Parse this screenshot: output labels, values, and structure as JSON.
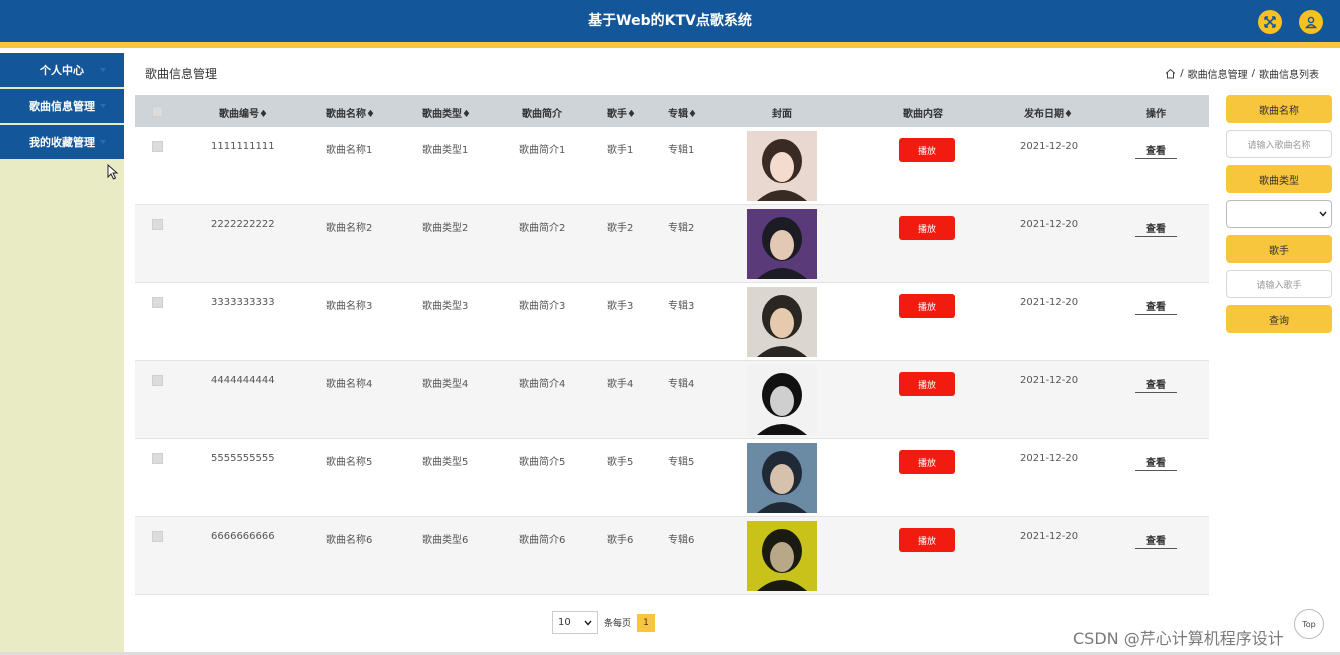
{
  "app": {
    "title": "基于Web的KTV点歌系统"
  },
  "header_icons": [
    "fullscreen-icon",
    "user-icon"
  ],
  "sidebar": {
    "items": [
      {
        "label": "个人中心"
      },
      {
        "label": "歌曲信息管理"
      },
      {
        "label": "我的收藏管理"
      }
    ]
  },
  "page": {
    "title": "歌曲信息管理",
    "breadcrumb": [
      "歌曲信息管理",
      "歌曲信息列表"
    ],
    "breadcrumb_sep": "/"
  },
  "table": {
    "columns": [
      "歌曲编号",
      "歌曲名称",
      "歌曲类型",
      "歌曲简介",
      "歌手",
      "专辑",
      "封面",
      "歌曲内容",
      "发布日期",
      "操作"
    ],
    "sortable_marker": "♦",
    "play_label": "播放",
    "view_label": "查看",
    "rows": [
      {
        "id": "1111111111",
        "name": "歌曲名称1",
        "type": "歌曲类型1",
        "intro": "歌曲简介1",
        "singer": "歌手1",
        "album": "专辑1",
        "date": "2021-12-20"
      },
      {
        "id": "2222222222",
        "name": "歌曲名称2",
        "type": "歌曲类型2",
        "intro": "歌曲简介2",
        "singer": "歌手2",
        "album": "专辑2",
        "date": "2021-12-20"
      },
      {
        "id": "3333333333",
        "name": "歌曲名称3",
        "type": "歌曲类型3",
        "intro": "歌曲简介3",
        "singer": "歌手3",
        "album": "专辑3",
        "date": "2021-12-20"
      },
      {
        "id": "4444444444",
        "name": "歌曲名称4",
        "type": "歌曲类型4",
        "intro": "歌曲简介4",
        "singer": "歌手4",
        "album": "专辑4",
        "date": "2021-12-20"
      },
      {
        "id": "5555555555",
        "name": "歌曲名称5",
        "type": "歌曲类型5",
        "intro": "歌曲简介5",
        "singer": "歌手5",
        "album": "专辑5",
        "date": "2021-12-20"
      },
      {
        "id": "6666666666",
        "name": "歌曲名称6",
        "type": "歌曲类型6",
        "intro": "歌曲简介6",
        "singer": "歌手6",
        "album": "专辑6",
        "date": "2021-12-20"
      }
    ]
  },
  "pagination": {
    "page_size": "10",
    "per_page_label": "条每页",
    "current_page": "1"
  },
  "search": {
    "name_label": "歌曲名称",
    "name_placeholder": "请输入歌曲名称",
    "type_label": "歌曲类型",
    "type_value": "",
    "singer_label": "歌手",
    "singer_placeholder": "请输入歌手",
    "query_label": "查询"
  },
  "top_button": "Top",
  "watermark": "CSDN @芹心计算机程序设计",
  "colors": {
    "header": "#14569a",
    "accent": "#f7c63c",
    "sidebar_bg": "#e9ebc4",
    "play": "#f21b0f"
  }
}
